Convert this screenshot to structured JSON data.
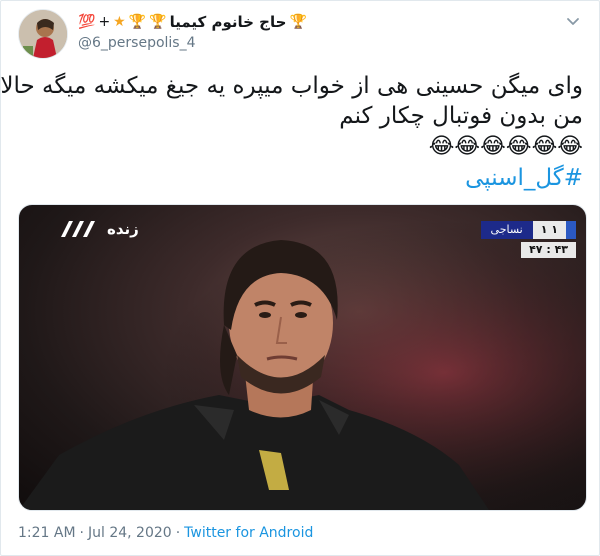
{
  "user": {
    "display_name": "حاج خانوم کیمیا",
    "badge_emojis": [
      "🏆",
      "🏆",
      "🏆",
      "★",
      "+",
      "💯"
    ],
    "handle": "@6_persepolis_4"
  },
  "tweet": {
    "lines": [
      "وای میگن حسینی هی از خواب میپره یه جیغ میکشه میگه حالا",
      "من بدون فوتبال چکار کنم"
    ],
    "laugh_emoji": "😂",
    "laugh_count": 6,
    "hashtag": "#گل_اسنپی"
  },
  "media": {
    "live_label": "زنده",
    "score": {
      "team": "نساجی",
      "goals": "۱ ۱",
      "clock": "۴۷ : ۴۳"
    }
  },
  "footer": {
    "time": "1:21 AM",
    "separator": "·",
    "date": "Jul 24, 2020",
    "source": "Twitter for Android"
  },
  "colors": {
    "link": "#1b95e0",
    "muted": "#657786",
    "text": "#14171a"
  },
  "icons": {
    "caret": "chevron-down-icon",
    "live": "tv-channel-3-logo"
  }
}
